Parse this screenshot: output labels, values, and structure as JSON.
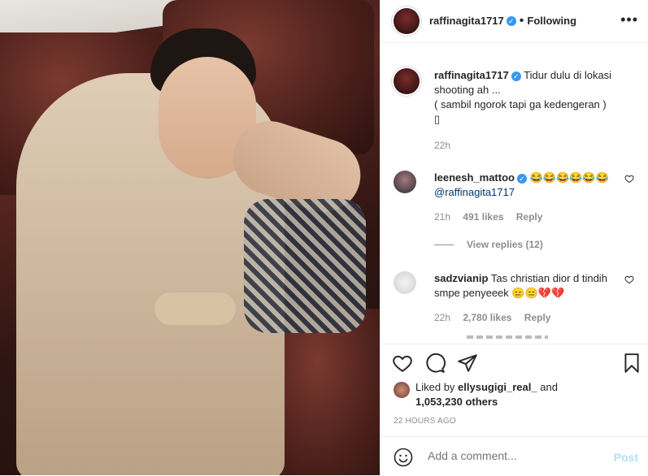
{
  "post": {
    "username": "raffinagita1717",
    "follow_status": "Following",
    "caption_lines": [
      "Tidur dulu di lokasi",
      "shooting ah ...",
      "( sambil ngorok tapi ga kedengeran )",
      "▯"
    ],
    "caption_time": "22h"
  },
  "comments": [
    {
      "username": "leenesh_mattoo",
      "text": "😂😂😂😂😂😂",
      "mention": "@raffinagita1717",
      "time": "21h",
      "likes": "491 likes",
      "reply_label": "Reply",
      "view_replies": "View replies (12)"
    },
    {
      "username": "sadzvianip",
      "text": "Tas christian dior d tindih smpe penyeeek 😑😑💔💔",
      "time": "22h",
      "likes": "2,780 likes",
      "reply_label": "Reply"
    }
  ],
  "likes_summary": {
    "prefix": "Liked by",
    "user": "ellysugigi_real_",
    "and": "and",
    "count": "1,053,230 others"
  },
  "timestamp": "22 HOURS AGO",
  "add_comment": {
    "placeholder": "Add a comment...",
    "post_label": "Post"
  },
  "icons": {
    "more": "more-options-icon",
    "heart": "heart-icon",
    "comment": "comment-icon",
    "share": "share-icon",
    "save": "bookmark-icon",
    "emoji": "emoji-icon",
    "verified": "verified-badge-icon"
  },
  "colors": {
    "link": "#00376b",
    "verified": "#3897f0",
    "muted": "#8e8e8e",
    "post_disabled": "#b2dffc"
  }
}
